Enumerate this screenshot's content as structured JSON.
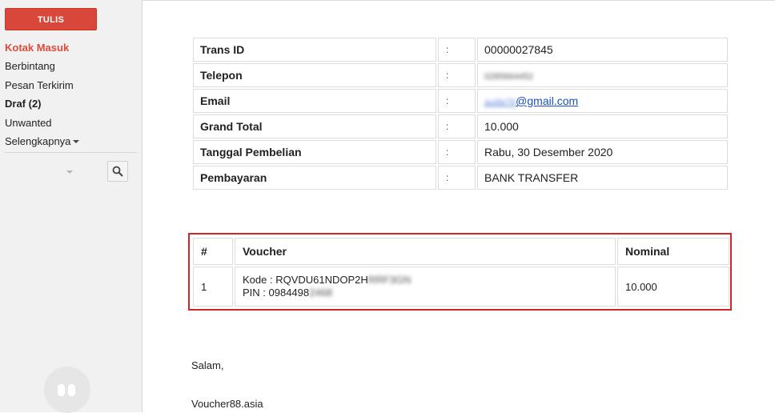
{
  "sidebar": {
    "compose_label": "TULIS",
    "items": [
      {
        "label": "Kotak Masuk"
      },
      {
        "label": "Berbintang"
      },
      {
        "label": "Pesan Terkirim"
      },
      {
        "label": "Draf (2)"
      },
      {
        "label": "Unwanted"
      },
      {
        "label": "Selengkapnya"
      }
    ]
  },
  "info": {
    "rows": [
      {
        "label": "Trans ID",
        "sep": ":",
        "value": "00000027845"
      },
      {
        "label": "Telepon",
        "sep": ":",
        "value": "0285664452"
      },
      {
        "label": "Email",
        "sep": ":",
        "value_prefix": "audie76",
        "value_suffix": "@gmail.com"
      },
      {
        "label": "Grand Total",
        "sep": ":",
        "value": "10.000"
      },
      {
        "label": "Tanggal Pembelian",
        "sep": ":",
        "value": "Rabu, 30 Desember 2020"
      },
      {
        "label": "Pembayaran",
        "sep": ":",
        "value": "BANK TRANSFER"
      }
    ]
  },
  "voucher": {
    "headers": {
      "num": "#",
      "voucher": "Voucher",
      "nominal": "Nominal"
    },
    "rows": [
      {
        "num": "1",
        "kode_label": "Kode : RQVDU61NDOP2H",
        "kode_hidden": "RRF3GN",
        "pin_label": "PIN : 0984498",
        "pin_hidden": "2468",
        "nominal": "10.000"
      }
    ]
  },
  "footer": {
    "greeting": "Salam,",
    "signature": "Voucher88.asia"
  },
  "colors": {
    "accent": "#dd4b39",
    "compose_bg": "#d9473b",
    "highlight_border": "#d3242c",
    "link": "#1a4fc4"
  }
}
